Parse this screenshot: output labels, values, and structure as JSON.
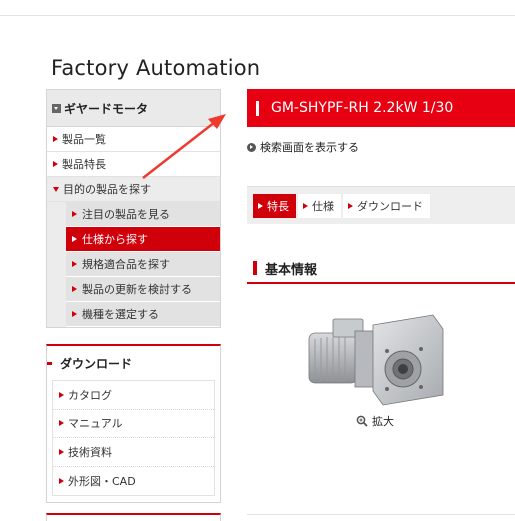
{
  "site": {
    "title": "Factory Automation"
  },
  "sidebar": {
    "heading": "ギヤードモータ",
    "items": [
      {
        "label": "製品一覧"
      },
      {
        "label": "製品特長"
      },
      {
        "label": "目的の製品を探す"
      }
    ],
    "subitems": [
      {
        "label": "注目の製品を見る"
      },
      {
        "label": "仕様から探す"
      },
      {
        "label": "規格適合品を探す"
      },
      {
        "label": "製品の更新を検討する"
      },
      {
        "label": "機種を選定する"
      }
    ]
  },
  "downloads": {
    "heading": "ダウンロード",
    "items": [
      {
        "label": "カタログ"
      },
      {
        "label": "マニュアル"
      },
      {
        "label": "技術資料"
      },
      {
        "label": "外形図・CAD"
      }
    ]
  },
  "product": {
    "name": "GM-SHYPF-RH 2.2kW 1/30",
    "search_link": "検索画面を表示する"
  },
  "tabs": [
    {
      "label": "特長"
    },
    {
      "label": "仕様"
    },
    {
      "label": "ダウンロード"
    }
  ],
  "section": {
    "title": "基本情報"
  },
  "image": {
    "zoom_label": "拡大"
  },
  "colors": {
    "accent": "#d0000b",
    "banner": "#e60012",
    "annotation_arrow": "#ee3a2e"
  }
}
